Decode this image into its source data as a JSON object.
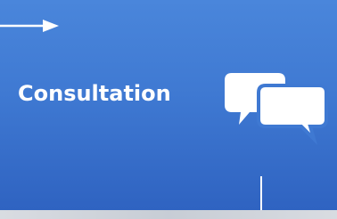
{
  "tile": {
    "title": "Consultation",
    "background_color": "#3f79d2",
    "text_color": "#ffffff"
  },
  "icons": {
    "arrow": "right-arrow-icon",
    "chat": "chat-bubbles-icon"
  }
}
